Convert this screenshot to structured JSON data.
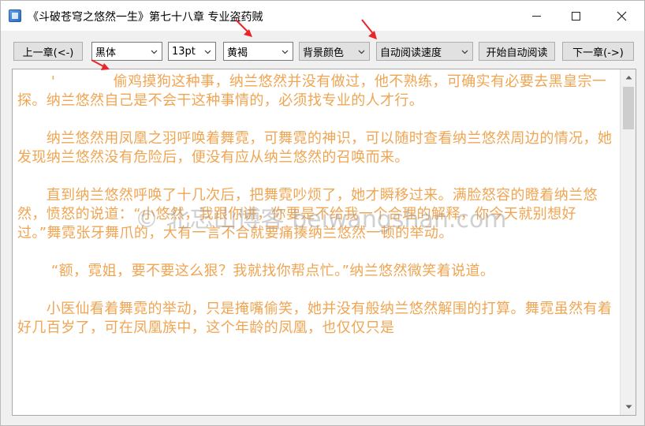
{
  "window": {
    "title": "《斗破苍穹之悠然一生》第七十八章 专业盗药贼",
    "icon": "app-icon"
  },
  "toolbar": {
    "prev_chapter": "上一章(<-)",
    "font_family": "黑体",
    "font_size": "13pt",
    "text_color": "黄褐",
    "bg_color": "背景颜色",
    "auto_speed": "自动阅读速度",
    "start_auto": "开始自动阅读",
    "next_chapter": "下一章(->)"
  },
  "content": {
    "paragraphs": [
      "       '            偷鸡摸狗这种事，纳兰悠然并没有做过，他不熟练，可确实有必要去黑皇宗一探。纳兰悠然自己是不会干这种事情的，必须找专业的人才行。",
      "      纳兰悠然用凤凰之羽呼唤着舞霓，可舞霓的神识，可以随时查看纳兰悠然周边的情况，她发现纳兰悠然没有危险后，便没有应从纳兰悠然的召唤而来。",
      "      直到纳兰悠然呼唤了十几次后，把舞霓吵烦了，她才瞬移过来。满脸怒容的瞪着纳兰悠然，愤怒的说道：“小悠然，我跟你讲，你要是不给我一个合理的解释，你今天就别想好过。”舞霓张牙舞爪的，大有一言不合就要痛揍纳兰悠然一顿的举动。",
      "       “额，霓姐，要不要这么狠？我就找你帮点忙。”纳兰悠然微笑着说道。",
      "      小医仙看着舞霓的举动，只是掩嘴偷笑，她并没有般纳兰悠然解围的打算。舞霓虽然有着好几百岁了，可在凤凰族中，这个年龄的凤凰，也仅仅只是"
    ]
  },
  "watermark": "© 北忘山博客 beiwangshan.com",
  "colors": {
    "text": "#f0a552",
    "arrow": "#e8262a"
  }
}
